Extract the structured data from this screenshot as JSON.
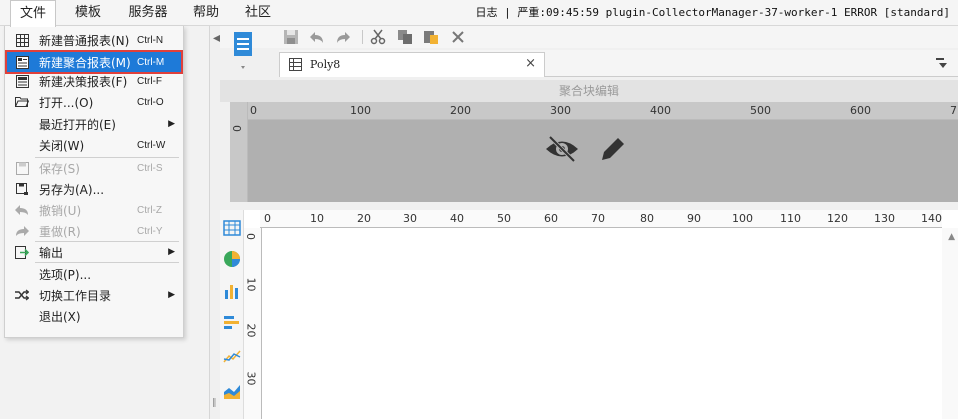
{
  "menubar": {
    "items": [
      {
        "label": "文件",
        "active": true
      },
      {
        "label": "模板"
      },
      {
        "label": "服务器"
      },
      {
        "label": "帮助"
      },
      {
        "label": "社区"
      }
    ],
    "log_status": "日志 | 严重:09:45:59 plugin-CollectorManager-37-worker-1 ERROR [standard]"
  },
  "file_menu": [
    {
      "label": "新建普通报表(N)",
      "shortcut": "Ctrl-N",
      "icon": "grid-report-icon"
    },
    {
      "label": "新建聚合报表(M)",
      "shortcut": "Ctrl-M",
      "icon": "aggregate-report-icon",
      "highlight": true
    },
    {
      "label": "新建决策报表(F)",
      "shortcut": "Ctrl-F",
      "icon": "decision-report-icon"
    },
    {
      "label": "打开...(O)",
      "shortcut": "Ctrl-O",
      "icon": "folder-open-icon"
    },
    {
      "label": "最近打开的(E)",
      "shortcut": "",
      "submenu": true
    },
    {
      "label": "关闭(W)",
      "shortcut": "Ctrl-W"
    },
    {
      "label": "保存(S)",
      "shortcut": "Ctrl-S",
      "icon": "save-icon",
      "disabled": true
    },
    {
      "label": "另存为(A)...",
      "shortcut": "",
      "icon": "save-as-icon"
    },
    {
      "label": "撤销(U)",
      "shortcut": "Ctrl-Z",
      "icon": "undo-icon",
      "disabled": true
    },
    {
      "label": "重做(R)",
      "shortcut": "Ctrl-Y",
      "icon": "redo-icon",
      "disabled": true
    },
    {
      "label": "输出",
      "shortcut": "",
      "icon": "export-icon",
      "submenu": true
    },
    {
      "label": "选项(P)...",
      "shortcut": ""
    },
    {
      "label": "切换工作目录",
      "shortcut": "",
      "icon": "shuffle-icon",
      "submenu": true
    },
    {
      "label": "退出(X)",
      "shortcut": ""
    }
  ],
  "tab": {
    "title": "Poly8",
    "close": "×"
  },
  "agg_editor": {
    "header": "聚合块编辑",
    "ruler_labels": [
      "0",
      "100",
      "200",
      "300",
      "400",
      "500",
      "600",
      "7"
    ],
    "vruler_label": "0"
  },
  "canvas": {
    "ruler_labels": [
      "0",
      "10",
      "20",
      "30",
      "40",
      "50",
      "60",
      "70",
      "80",
      "90",
      "100",
      "110",
      "120",
      "130",
      "140"
    ],
    "vruler_labels": [
      "0",
      "10",
      "20",
      "30"
    ]
  },
  "glyphs": {
    "submenu_arrow": "▶",
    "collapse": "◀",
    "scroll_up": "▲",
    "grip": "‖"
  },
  "colors": {
    "highlight": "#1e7ad8",
    "highlight_border": "#e0403b"
  }
}
